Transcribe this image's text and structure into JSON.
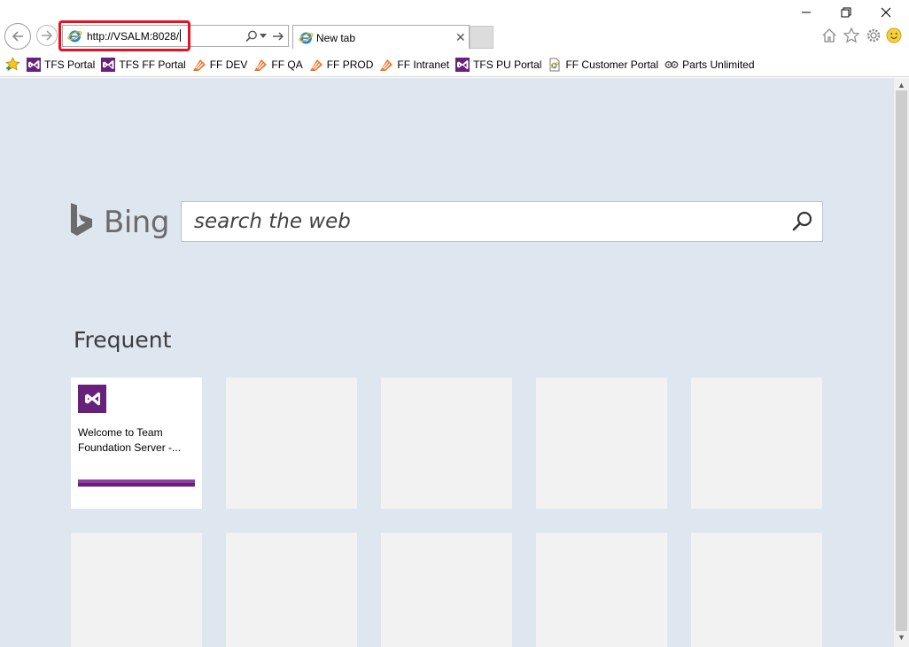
{
  "window": {
    "minimize_icon": "minimize-icon",
    "restore_icon": "restore-icon",
    "close_icon": "close-icon"
  },
  "address_bar": {
    "url": "http://VSALM:8028/",
    "highlight_color": "#e81123"
  },
  "tabs": [
    {
      "label": "New tab",
      "close": "✕"
    }
  ],
  "toolbar": {
    "icons": [
      "home-icon",
      "star-icon",
      "gear-icon",
      "smiley-icon"
    ]
  },
  "favorites": [
    {
      "label": "TFS Portal",
      "icon": "vs"
    },
    {
      "label": "TFS FF Portal",
      "icon": "vs"
    },
    {
      "label": "FF DEV",
      "icon": "jenkins"
    },
    {
      "label": "FF QA",
      "icon": "jenkins"
    },
    {
      "label": "FF PROD",
      "icon": "jenkins"
    },
    {
      "label": "FF Intranet",
      "icon": "jenkins"
    },
    {
      "label": "TFS PU Portal",
      "icon": "vs"
    },
    {
      "label": "FF Customer Portal",
      "icon": "page"
    },
    {
      "label": "Parts Unlimited",
      "icon": "parts"
    }
  ],
  "bing": {
    "logo_text": "Bing",
    "search_placeholder": "search the web"
  },
  "frequent": {
    "heading": "Frequent",
    "tiles": [
      {
        "title": "Welcome to Team Foundation Server -...",
        "icon": "visual-studio-icon",
        "accent": "#68217a"
      }
    ]
  },
  "colors": {
    "page_background": "#dee6ef",
    "tile_empty": "#f2f2f2",
    "tfs_purple": "#68217a"
  }
}
